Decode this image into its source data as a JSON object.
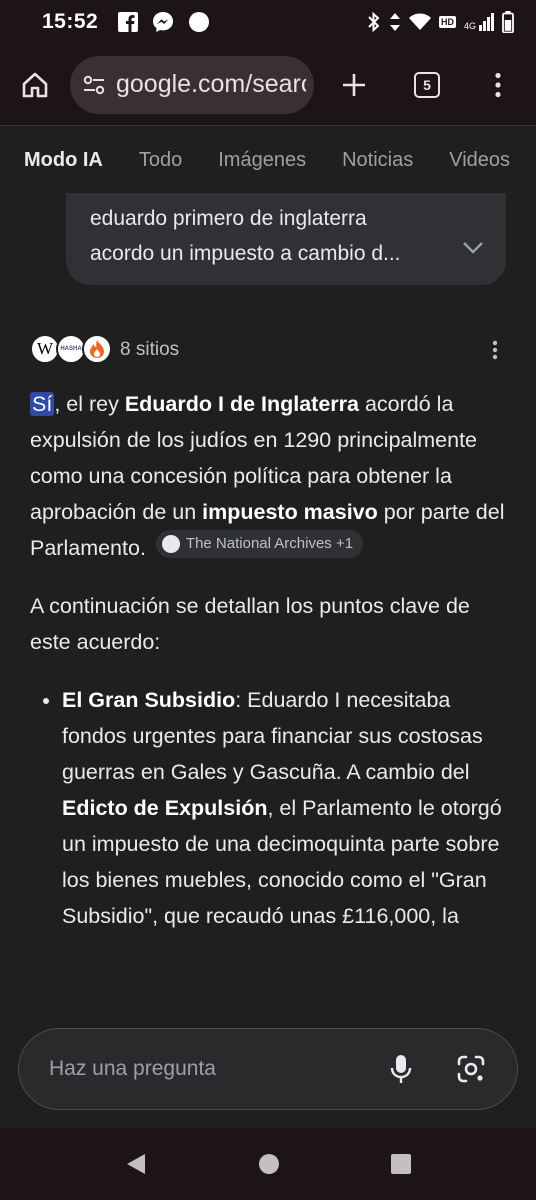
{
  "status_bar": {
    "time": "15:52",
    "icons": [
      "facebook-icon",
      "messenger-icon",
      "circle-icon",
      "bluetooth-icon",
      "data-arrows-icon",
      "wifi-icon",
      "hd-icon",
      "signal-4g-icon",
      "battery-icon"
    ],
    "network": "4G",
    "hd": "HD"
  },
  "browser": {
    "url": "google.com/search",
    "tab_count": "5"
  },
  "mode_tabs": [
    {
      "label": "Modo IA",
      "active": true
    },
    {
      "label": "Todo",
      "active": false
    },
    {
      "label": "Imágenes",
      "active": false
    },
    {
      "label": "Noticias",
      "active": false
    },
    {
      "label": "Videos",
      "active": false
    }
  ],
  "query": {
    "line1": "eduardo primero de inglaterra",
    "line2": "acordo un impuesto a cambio d..."
  },
  "sources": {
    "label": "8 sitios",
    "favicon_w": "W",
    "favicon_h": "HASHA"
  },
  "answer": {
    "p1_yes": "Sí",
    "p1_a": ", el rey ",
    "p1_b": "Eduardo I de Inglaterra",
    "p1_c": " acordó la expulsión de los judíos en 1290 principalmente como una concesión política para obtener la aprobación de un ",
    "p1_d": "impuesto masivo",
    "p1_e": " por parte del Parlamento.",
    "chip": "The National Archives +1",
    "p2": "A continuación se detallan los puntos clave de este acuerdo:",
    "bullet1_title": "El Gran Subsidio",
    "bullet1_a": ": Eduardo I necesitaba fondos urgentes para financiar sus costosas guerras en Gales y Gascuña. A cambio del ",
    "bullet1_b": "Edicto de Expulsión",
    "bullet1_c": ", el Parlamento le otorgó un impuesto de una decimoquinta parte sobre los bienes muebles, conocido como el \"Gran Subsidio\", que recaudó unas £116,000, la"
  },
  "ask": {
    "placeholder": "Haz una pregunta"
  }
}
